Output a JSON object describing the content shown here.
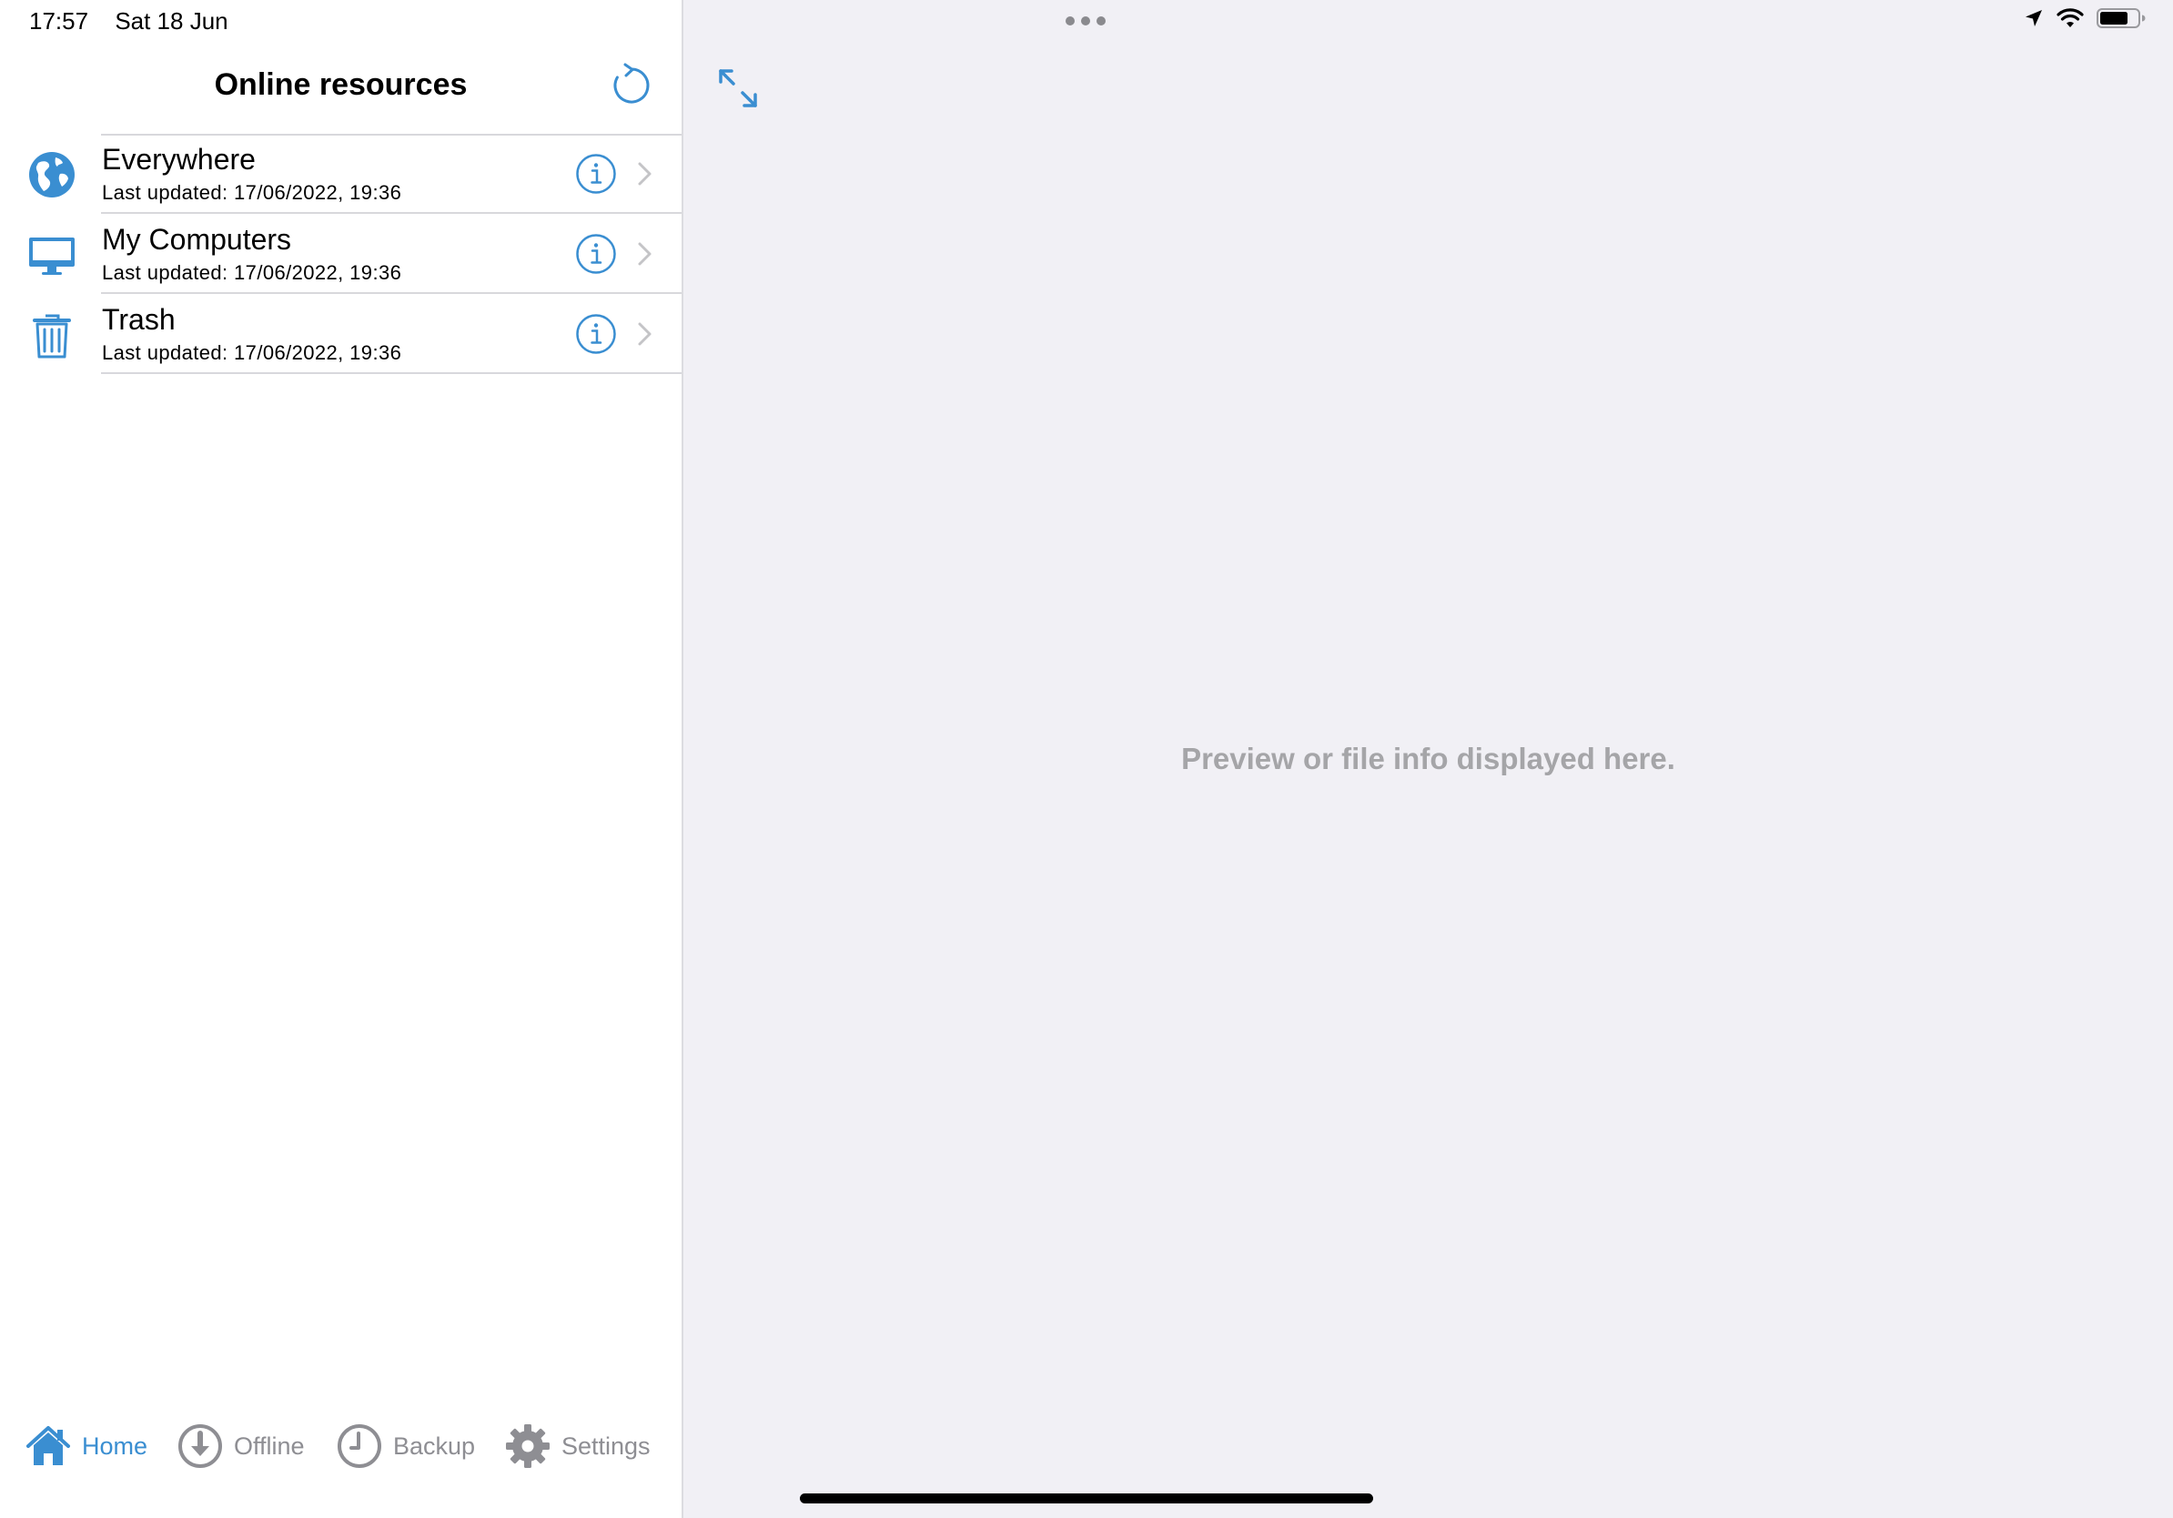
{
  "status_bar": {
    "time": "17:57",
    "date": "Sat 18 Jun"
  },
  "master": {
    "title": "Online resources",
    "items": [
      {
        "title": "Everywhere",
        "subtitle": "Last updated: 17/06/2022, 19:36",
        "icon": "globe-icon"
      },
      {
        "title": "My Computers",
        "subtitle": "Last updated: 17/06/2022, 19:36",
        "icon": "computer-icon"
      },
      {
        "title": "Trash",
        "subtitle": "Last updated: 17/06/2022, 19:36",
        "icon": "trash-icon"
      }
    ]
  },
  "tabs": [
    {
      "label": "Home",
      "icon": "home-icon",
      "active": true
    },
    {
      "label": "Offline",
      "icon": "download-icon",
      "active": false
    },
    {
      "label": "Backup",
      "icon": "clock-icon",
      "active": false
    },
    {
      "label": "Settings",
      "icon": "gear-icon",
      "active": false
    }
  ],
  "detail": {
    "placeholder": "Preview or file info displayed here."
  },
  "colors": {
    "accent": "#3a8ed1",
    "inactive": "#8e8e93",
    "detail_background": "#f1f0f5",
    "placeholder_text": "#a5a5a8"
  }
}
